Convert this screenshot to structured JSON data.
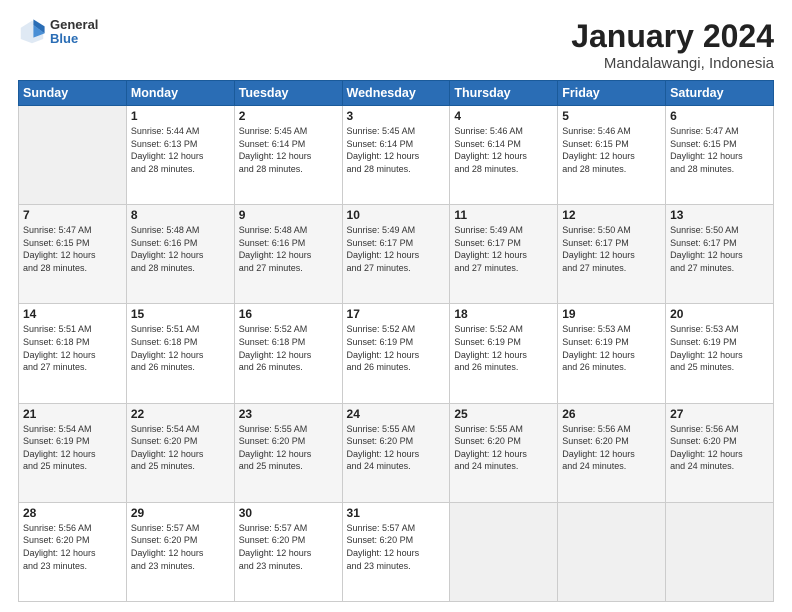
{
  "header": {
    "logo_general": "General",
    "logo_blue": "Blue",
    "title": "January 2024",
    "subtitle": "Mandalawangi, Indonesia"
  },
  "weekdays": [
    "Sunday",
    "Monday",
    "Tuesday",
    "Wednesday",
    "Thursday",
    "Friday",
    "Saturday"
  ],
  "weeks": [
    [
      {
        "day": "",
        "info": ""
      },
      {
        "day": "1",
        "info": "Sunrise: 5:44 AM\nSunset: 6:13 PM\nDaylight: 12 hours\nand 28 minutes."
      },
      {
        "day": "2",
        "info": "Sunrise: 5:45 AM\nSunset: 6:14 PM\nDaylight: 12 hours\nand 28 minutes."
      },
      {
        "day": "3",
        "info": "Sunrise: 5:45 AM\nSunset: 6:14 PM\nDaylight: 12 hours\nand 28 minutes."
      },
      {
        "day": "4",
        "info": "Sunrise: 5:46 AM\nSunset: 6:14 PM\nDaylight: 12 hours\nand 28 minutes."
      },
      {
        "day": "5",
        "info": "Sunrise: 5:46 AM\nSunset: 6:15 PM\nDaylight: 12 hours\nand 28 minutes."
      },
      {
        "day": "6",
        "info": "Sunrise: 5:47 AM\nSunset: 6:15 PM\nDaylight: 12 hours\nand 28 minutes."
      }
    ],
    [
      {
        "day": "7",
        "info": "Sunrise: 5:47 AM\nSunset: 6:15 PM\nDaylight: 12 hours\nand 28 minutes."
      },
      {
        "day": "8",
        "info": "Sunrise: 5:48 AM\nSunset: 6:16 PM\nDaylight: 12 hours\nand 28 minutes."
      },
      {
        "day": "9",
        "info": "Sunrise: 5:48 AM\nSunset: 6:16 PM\nDaylight: 12 hours\nand 27 minutes."
      },
      {
        "day": "10",
        "info": "Sunrise: 5:49 AM\nSunset: 6:17 PM\nDaylight: 12 hours\nand 27 minutes."
      },
      {
        "day": "11",
        "info": "Sunrise: 5:49 AM\nSunset: 6:17 PM\nDaylight: 12 hours\nand 27 minutes."
      },
      {
        "day": "12",
        "info": "Sunrise: 5:50 AM\nSunset: 6:17 PM\nDaylight: 12 hours\nand 27 minutes."
      },
      {
        "day": "13",
        "info": "Sunrise: 5:50 AM\nSunset: 6:17 PM\nDaylight: 12 hours\nand 27 minutes."
      }
    ],
    [
      {
        "day": "14",
        "info": "Sunrise: 5:51 AM\nSunset: 6:18 PM\nDaylight: 12 hours\nand 27 minutes."
      },
      {
        "day": "15",
        "info": "Sunrise: 5:51 AM\nSunset: 6:18 PM\nDaylight: 12 hours\nand 26 minutes."
      },
      {
        "day": "16",
        "info": "Sunrise: 5:52 AM\nSunset: 6:18 PM\nDaylight: 12 hours\nand 26 minutes."
      },
      {
        "day": "17",
        "info": "Sunrise: 5:52 AM\nSunset: 6:19 PM\nDaylight: 12 hours\nand 26 minutes."
      },
      {
        "day": "18",
        "info": "Sunrise: 5:52 AM\nSunset: 6:19 PM\nDaylight: 12 hours\nand 26 minutes."
      },
      {
        "day": "19",
        "info": "Sunrise: 5:53 AM\nSunset: 6:19 PM\nDaylight: 12 hours\nand 26 minutes."
      },
      {
        "day": "20",
        "info": "Sunrise: 5:53 AM\nSunset: 6:19 PM\nDaylight: 12 hours\nand 25 minutes."
      }
    ],
    [
      {
        "day": "21",
        "info": "Sunrise: 5:54 AM\nSunset: 6:19 PM\nDaylight: 12 hours\nand 25 minutes."
      },
      {
        "day": "22",
        "info": "Sunrise: 5:54 AM\nSunset: 6:20 PM\nDaylight: 12 hours\nand 25 minutes."
      },
      {
        "day": "23",
        "info": "Sunrise: 5:55 AM\nSunset: 6:20 PM\nDaylight: 12 hours\nand 25 minutes."
      },
      {
        "day": "24",
        "info": "Sunrise: 5:55 AM\nSunset: 6:20 PM\nDaylight: 12 hours\nand 24 minutes."
      },
      {
        "day": "25",
        "info": "Sunrise: 5:55 AM\nSunset: 6:20 PM\nDaylight: 12 hours\nand 24 minutes."
      },
      {
        "day": "26",
        "info": "Sunrise: 5:56 AM\nSunset: 6:20 PM\nDaylight: 12 hours\nand 24 minutes."
      },
      {
        "day": "27",
        "info": "Sunrise: 5:56 AM\nSunset: 6:20 PM\nDaylight: 12 hours\nand 24 minutes."
      }
    ],
    [
      {
        "day": "28",
        "info": "Sunrise: 5:56 AM\nSunset: 6:20 PM\nDaylight: 12 hours\nand 23 minutes."
      },
      {
        "day": "29",
        "info": "Sunrise: 5:57 AM\nSunset: 6:20 PM\nDaylight: 12 hours\nand 23 minutes."
      },
      {
        "day": "30",
        "info": "Sunrise: 5:57 AM\nSunset: 6:20 PM\nDaylight: 12 hours\nand 23 minutes."
      },
      {
        "day": "31",
        "info": "Sunrise: 5:57 AM\nSunset: 6:20 PM\nDaylight: 12 hours\nand 23 minutes."
      },
      {
        "day": "",
        "info": ""
      },
      {
        "day": "",
        "info": ""
      },
      {
        "day": "",
        "info": ""
      }
    ]
  ]
}
